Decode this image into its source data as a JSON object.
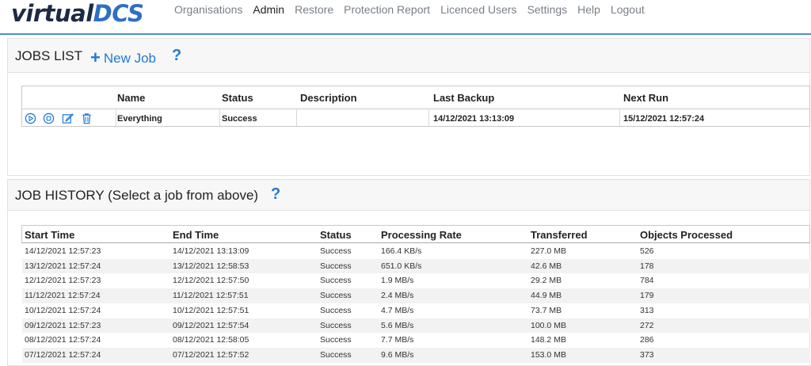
{
  "logo": {
    "part1": "virtual",
    "part2": "DCS"
  },
  "nav": [
    {
      "label": "Organisations",
      "name": "nav-organisations",
      "active": false
    },
    {
      "label": "Admin",
      "name": "nav-admin",
      "active": true
    },
    {
      "label": "Restore",
      "name": "nav-restore",
      "active": false
    },
    {
      "label": "Protection Report",
      "name": "nav-protection-report",
      "active": false
    },
    {
      "label": "Licenced Users",
      "name": "nav-licenced-users",
      "active": false
    },
    {
      "label": "Settings",
      "name": "nav-settings",
      "active": false
    },
    {
      "label": "Help",
      "name": "nav-help",
      "active": false
    },
    {
      "label": "Logout",
      "name": "nav-logout",
      "active": false
    }
  ],
  "jobs_list": {
    "title": "JOBS LIST",
    "new_job": "New Job",
    "help": "?",
    "columns": [
      "Name",
      "Status",
      "Description",
      "Last Backup",
      "Next Run"
    ],
    "rows": [
      {
        "name": "Everything",
        "status": "Success",
        "description": "",
        "last_backup": "14/12/2021 13:13:09",
        "next_run": "15/12/2021 12:57:24"
      }
    ],
    "row_actions": [
      "play-icon",
      "stop-icon",
      "edit-icon",
      "delete-icon"
    ]
  },
  "job_history": {
    "title": "JOB HISTORY (Select a job from above)",
    "help": "?",
    "columns": [
      "Start Time",
      "End Time",
      "Status",
      "Processing Rate",
      "Transferred",
      "Objects Processed"
    ],
    "rows": [
      [
        "14/12/2021 12:57:23",
        "14/12/2021 13:13:09",
        "Success",
        "166.4 KB/s",
        "227.0 MB",
        "526"
      ],
      [
        "13/12/2021 12:57:24",
        "13/12/2021 12:58:53",
        "Success",
        "651.0 KB/s",
        "42.6 MB",
        "178"
      ],
      [
        "12/12/2021 12:57:23",
        "12/12/2021 12:57:50",
        "Success",
        "1.9 MB/s",
        "29.2 MB",
        "784"
      ],
      [
        "11/12/2021 12:57:24",
        "11/12/2021 12:57:51",
        "Success",
        "2.4 MB/s",
        "44.9 MB",
        "179"
      ],
      [
        "10/12/2021 12:57:24",
        "10/12/2021 12:57:51",
        "Success",
        "4.7 MB/s",
        "73.7 MB",
        "313"
      ],
      [
        "09/12/2021 12:57:23",
        "09/12/2021 12:57:54",
        "Success",
        "5.6 MB/s",
        "100.0 MB",
        "272"
      ],
      [
        "08/12/2021 12:57:24",
        "08/12/2021 12:58:05",
        "Success",
        "7.7 MB/s",
        "148.2 MB",
        "286"
      ],
      [
        "07/12/2021 12:57:24",
        "07/12/2021 12:57:52",
        "Success",
        "9.6 MB/s",
        "153.0 MB",
        "373"
      ]
    ]
  },
  "colors": {
    "accent": "#1f7ad8",
    "logo_dark": "#1d2a44",
    "logo_blue": "#2f6fc4",
    "nav_text": "#7a8088"
  }
}
